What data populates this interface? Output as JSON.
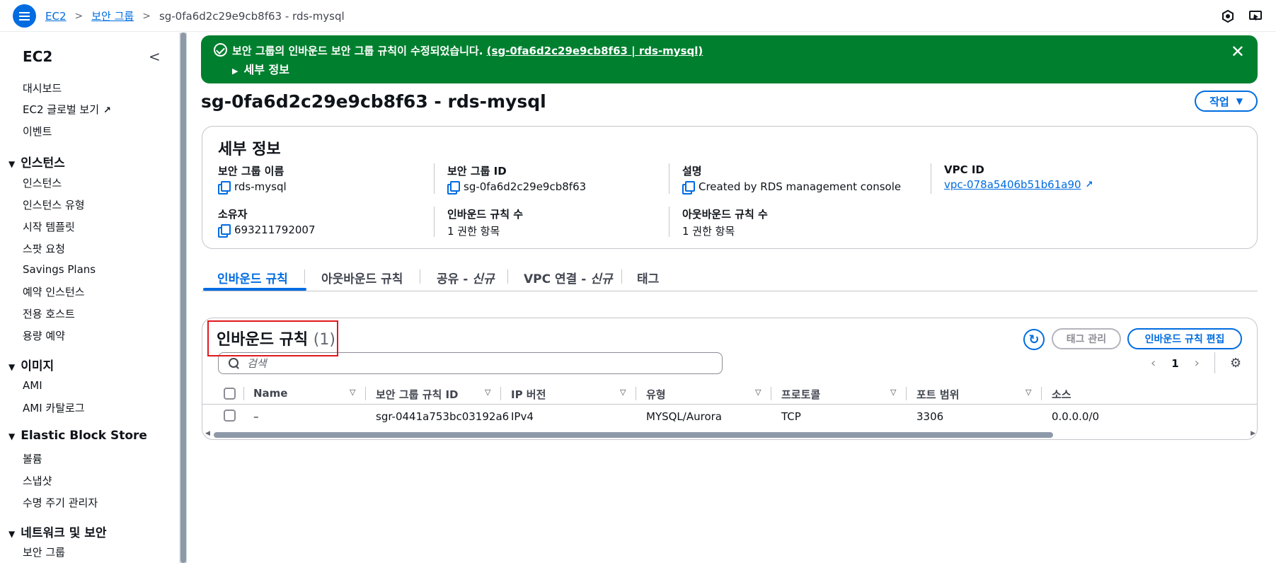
{
  "topbar": {
    "breadcrumb": [
      "EC2",
      "보안 그룹",
      "sg-0fa6d2c29e9cb8f63 - rds-mysql"
    ]
  },
  "sidebar": {
    "title": "EC2",
    "items": [
      "대시보드",
      "EC2 글로벌 보기",
      "이벤트"
    ],
    "sections": [
      {
        "title": "인스턴스",
        "items": [
          "인스턴스",
          "인스턴스 유형",
          "시작 템플릿",
          "스팟 요청",
          "Savings Plans",
          "예약 인스턴스",
          "전용 호스트",
          "용량 예약"
        ]
      },
      {
        "title": "이미지",
        "items": [
          "AMI",
          "AMI 카탈로그"
        ]
      },
      {
        "title": "Elastic Block Store",
        "items": [
          "볼륨",
          "스냅샷",
          "수명 주기 관리자"
        ]
      },
      {
        "title": "네트워크 및 보안",
        "items": [
          "보안 그룹"
        ]
      }
    ]
  },
  "flash": {
    "message": "보안 그룹의 인바운드 보안 그룹 규칙이 수정되었습니다.",
    "link": "(sg-0fa6d2c29e9cb8f63 | rds-mysql)",
    "details": "세부 정보",
    "color": "#00802f"
  },
  "page": {
    "title": "sg-0fa6d2c29e9cb8f63 - rds-mysql",
    "action_label": "작업"
  },
  "details": {
    "title": "세부 정보",
    "sg_name_label": "보안 그룹 이름",
    "sg_name": "rds-mysql",
    "sg_id_label": "보안 그룹 ID",
    "sg_id": "sg-0fa6d2c29e9cb8f63",
    "desc_label": "설명",
    "desc": "Created by RDS management console",
    "vpc_label": "VPC ID",
    "vpc": "vpc-078a5406b51b61a90",
    "owner_label": "소유자",
    "owner": "693211792007",
    "inbound_count_label": "인바운드 규칙 수",
    "inbound_count": "1 권한 항목",
    "outbound_count_label": "아웃바운드 규칙 수",
    "outbound_count": "1 권한 항목"
  },
  "tabs": {
    "inbound": "인바운드 규칙",
    "outbound": "아웃바운드 규칙",
    "share_prefix": "공유 - ",
    "share_new": "신규",
    "vpc_prefix": "VPC 연결 - ",
    "vpc_new": "신규",
    "tags": "태그"
  },
  "rules": {
    "title": "인바운드 규칙",
    "count": "(1)",
    "manage_tags": "태그 관리",
    "edit": "인바운드 규칙 편집",
    "search_placeholder": "검색",
    "page": "1",
    "columns": [
      "Name",
      "보안 그룹 규칙 ID",
      "IP 버전",
      "유형",
      "프로토콜",
      "포트 범위",
      "소스"
    ],
    "rows": [
      [
        "–",
        "sgr-0441a753bc03192a6",
        "IPv4",
        "MYSQL/Aurora",
        "TCP",
        "3306",
        "0.0.0.0/0"
      ]
    ]
  },
  "colors": {
    "accent": "#006ce0",
    "highlight": "#e0181d"
  }
}
